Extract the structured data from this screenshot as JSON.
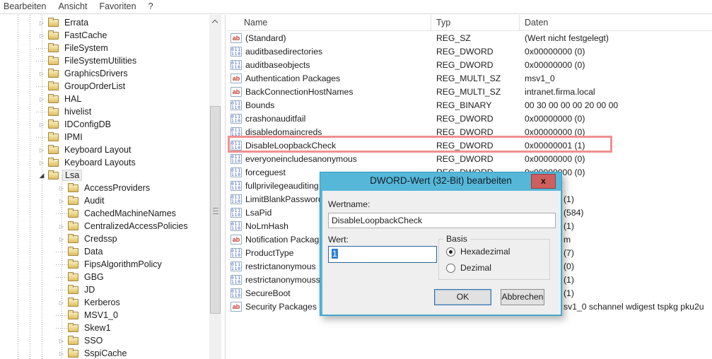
{
  "menu": {
    "items": [
      "Bearbeiten",
      "Ansicht",
      "Favoriten",
      "?"
    ]
  },
  "tree": {
    "items": [
      {
        "label": "Errata",
        "level": 1,
        "arrow": "collapsed"
      },
      {
        "label": "FastCache",
        "level": 1,
        "arrow": "collapsed"
      },
      {
        "label": "FileSystem",
        "level": 1,
        "arrow": "none"
      },
      {
        "label": "FileSystemUtilities",
        "level": 1,
        "arrow": "none"
      },
      {
        "label": "GraphicsDrivers",
        "level": 1,
        "arrow": "collapsed"
      },
      {
        "label": "GroupOrderList",
        "level": 1,
        "arrow": "none"
      },
      {
        "label": "HAL",
        "level": 1,
        "arrow": "collapsed"
      },
      {
        "label": "hivelist",
        "level": 1,
        "arrow": "none"
      },
      {
        "label": "IDConfigDB",
        "level": 1,
        "arrow": "collapsed"
      },
      {
        "label": "IPMI",
        "level": 1,
        "arrow": "none"
      },
      {
        "label": "Keyboard Layout",
        "level": 1,
        "arrow": "collapsed"
      },
      {
        "label": "Keyboard Layouts",
        "level": 1,
        "arrow": "collapsed"
      },
      {
        "label": "Lsa",
        "level": 1,
        "arrow": "expanded",
        "selected": true
      },
      {
        "label": "AccessProviders",
        "level": 2,
        "arrow": "collapsed"
      },
      {
        "label": "Audit",
        "level": 2,
        "arrow": "collapsed"
      },
      {
        "label": "CachedMachineNames",
        "level": 2,
        "arrow": "none"
      },
      {
        "label": "CentralizedAccessPolicies",
        "level": 2,
        "arrow": "collapsed"
      },
      {
        "label": "Credssp",
        "level": 2,
        "arrow": "collapsed"
      },
      {
        "label": "Data",
        "level": 2,
        "arrow": "none"
      },
      {
        "label": "FipsAlgorithmPolicy",
        "level": 2,
        "arrow": "none"
      },
      {
        "label": "GBG",
        "level": 2,
        "arrow": "none"
      },
      {
        "label": "JD",
        "level": 2,
        "arrow": "none"
      },
      {
        "label": "Kerberos",
        "level": 2,
        "arrow": "collapsed"
      },
      {
        "label": "MSV1_0",
        "level": 2,
        "arrow": "none"
      },
      {
        "label": "Skew1",
        "level": 2,
        "arrow": "none"
      },
      {
        "label": "SSO",
        "level": 2,
        "arrow": "collapsed"
      },
      {
        "label": "SspiCache",
        "level": 2,
        "arrow": "collapsed"
      }
    ]
  },
  "list": {
    "columns": [
      "Name",
      "Typ",
      "Daten"
    ],
    "rows": [
      {
        "name": "(Standard)",
        "icon": "sz",
        "typ": "REG_SZ",
        "daten": "(Wert nicht festgelegt)"
      },
      {
        "name": "auditbasedirectories",
        "icon": "bin",
        "typ": "REG_DWORD",
        "daten": "0x00000000 (0)"
      },
      {
        "name": "auditbaseobjects",
        "icon": "bin",
        "typ": "REG_DWORD",
        "daten": "0x00000000 (0)"
      },
      {
        "name": "Authentication Packages",
        "icon": "sz",
        "typ": "REG_MULTI_SZ",
        "daten": "msv1_0"
      },
      {
        "name": "BackConnectionHostNames",
        "icon": "sz",
        "typ": "REG_MULTI_SZ",
        "daten": "intranet.firma.local"
      },
      {
        "name": "Bounds",
        "icon": "bin",
        "typ": "REG_BINARY",
        "daten": "00 30 00 00 00 20 00 00"
      },
      {
        "name": "crashonauditfail",
        "icon": "bin",
        "typ": "REG_DWORD",
        "daten": "0x00000000 (0)"
      },
      {
        "name": "disabledomaincreds",
        "icon": "bin",
        "typ": "REG_DWORD",
        "daten": "0x00000000 (0)"
      },
      {
        "name": "DisableLoopbackCheck",
        "icon": "bin",
        "typ": "REG_DWORD",
        "daten": "0x00000001 (1)",
        "highlighted": true
      },
      {
        "name": "everyoneincludesanonymous",
        "icon": "bin",
        "typ": "REG_DWORD",
        "daten": "0x00000000 (0)"
      },
      {
        "name": "forceguest",
        "icon": "bin",
        "typ": "REG_DWORD",
        "daten": "0x00000000 (0)"
      },
      {
        "name": "fullprivilegeauditing",
        "icon": "bin",
        "typ": "",
        "daten": ""
      },
      {
        "name": "LimitBlankPassword",
        "icon": "bin",
        "typ": "",
        "daten": "",
        "daten_visible": "(1)"
      },
      {
        "name": "LsaPid",
        "icon": "bin",
        "typ": "",
        "daten": "",
        "daten_visible": "(584)"
      },
      {
        "name": "NoLmHash",
        "icon": "bin",
        "typ": "",
        "daten": "",
        "daten_visible": "(1)"
      },
      {
        "name": "Notification Packag",
        "icon": "sz",
        "typ": "",
        "daten": "",
        "daten_visible": "m"
      },
      {
        "name": "ProductType",
        "icon": "bin",
        "typ": "",
        "daten": "",
        "daten_visible": "(7)"
      },
      {
        "name": "restrictanonymous",
        "icon": "bin",
        "typ": "",
        "daten": "",
        "daten_visible": "(0)"
      },
      {
        "name": "restrictanonymouss",
        "icon": "bin",
        "typ": "",
        "daten": "",
        "daten_visible": "(1)"
      },
      {
        "name": "SecureBoot",
        "icon": "bin",
        "typ": "",
        "daten": "",
        "daten_visible": "(1)"
      },
      {
        "name": "Security Packages",
        "icon": "sz",
        "typ": "",
        "daten": "",
        "daten_visible": "sv1_0 schannel wdigest tspkg pku2u"
      }
    ]
  },
  "dialog": {
    "title": "DWORD-Wert (32-Bit) bearbeiten",
    "close_glyph": "x",
    "wertname_label": "Wertname:",
    "wertname_value": "DisableLoopbackCheck",
    "wert_label": "Wert:",
    "wert_value": "1",
    "basis_label": "Basis",
    "radio_hex_label": "Hexadezimal",
    "radio_dec_label": "Dezimal",
    "radio_selected": "Hexadezimal",
    "ok_label": "OK",
    "cancel_label": "Abbrechen"
  },
  "icons": {
    "sz": "ab-string-value-icon",
    "bin": "binary-dword-value-icon"
  },
  "colors": {
    "dialog_accent": "#56b7d9",
    "close_button": "#cd5f5f",
    "annotation_highlight": "#f09090",
    "text_selection": "#2e7fd4"
  }
}
